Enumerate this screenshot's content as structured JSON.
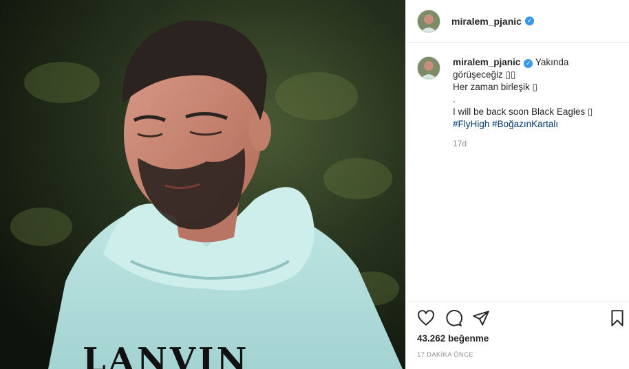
{
  "post": {
    "username": "miralem_pjanic",
    "verified": true,
    "caption_lines": [
      "Yakında",
      "görüşeceğiz ▯▯",
      "Her zaman birleşik ▯",
      ".",
      "I will be back soon Black Eagles ▯"
    ],
    "hashtags": [
      "#FlyHigh",
      "#BoğazınKartalı"
    ],
    "relative_time": "17d",
    "likes": "43.262 beğenme",
    "timestamp": "17 DAKİKA ÖNCE",
    "photo_print": "LANVIN"
  },
  "icons": {
    "like": "heart-icon",
    "comment": "comment-icon",
    "share": "share-icon",
    "save": "bookmark-icon",
    "verified": "verified-badge-icon"
  },
  "colors": {
    "verified": "#3897f0",
    "hashtag": "#00376b",
    "muted": "#8e8e8e",
    "text": "#262626"
  }
}
